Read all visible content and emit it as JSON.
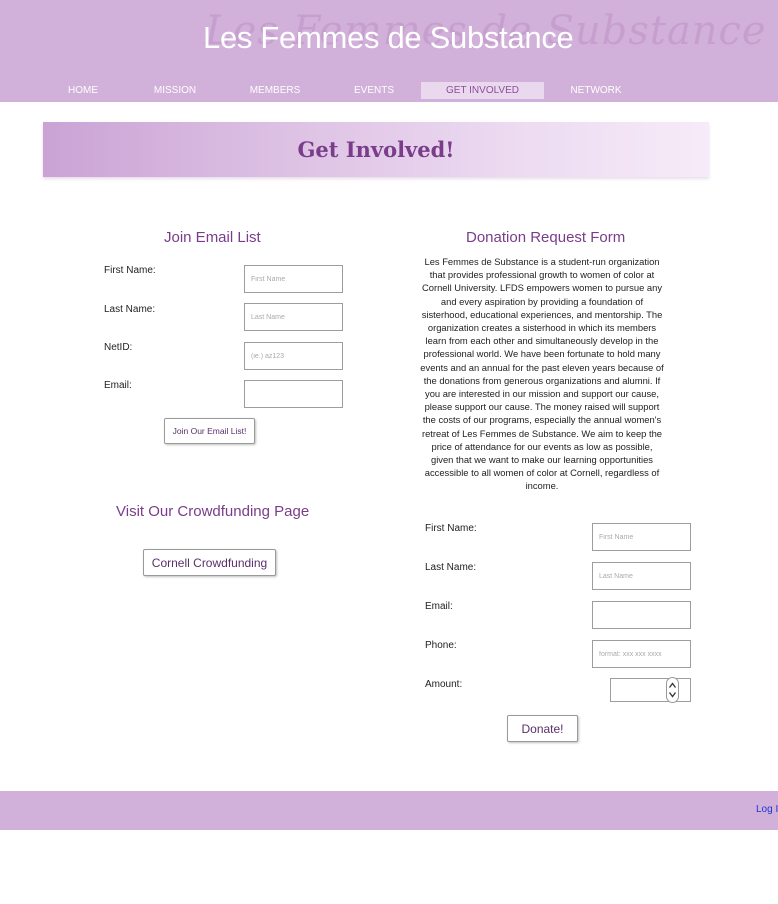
{
  "header": {
    "site_title": "Les Femmes de Substance",
    "nav": [
      {
        "label": "HOME"
      },
      {
        "label": "MISSION"
      },
      {
        "label": "MEMBERS"
      },
      {
        "label": "EVENTS"
      },
      {
        "label": "GET INVOLVED"
      },
      {
        "label": "NETWORK"
      }
    ]
  },
  "banner": {
    "title": "Get Involved!"
  },
  "email_list": {
    "heading": "Join Email List",
    "fields": [
      {
        "label": "First Name:",
        "placeholder": "First Name",
        "value": ""
      },
      {
        "label": "Last Name:",
        "placeholder": "Last Name",
        "value": ""
      },
      {
        "label": "NetID:",
        "placeholder": "(ie.) az123",
        "value": ""
      },
      {
        "label": "Email:",
        "placeholder": "",
        "value": ""
      }
    ],
    "submit_label": "Join Our Email List!"
  },
  "crowdfunding": {
    "heading": "Visit Our Crowdfunding Page",
    "button_label": "Cornell Crowdfunding"
  },
  "donation": {
    "heading": "Donation Request Form",
    "description": "Les Femmes de Substance is a student-run organization that provides professional growth to women of color at Cornell University. LFDS empowers women to pursue any and every aspiration by providing a foundation of sisterhood, educational experiences, and mentorship. The organization creates a sisterhood in which its members learn from each other and simultaneously develop in the professional world. We have been fortunate to hold many events and an annual for the past eleven years because of the donations from generous organizations and alumni. If you are interested in our mission and support our cause, please support our cause. The money raised will support the costs of our programs, especially the annual women's retreat of Les Femmes de Substance. We aim to keep the price of attendance for our events as low as possible, given that we want to make our learning opportunities accessible to all women of color at Cornell, regardless of income.",
    "fields": [
      {
        "label": "First Name:",
        "placeholder": "First Name",
        "value": ""
      },
      {
        "label": "Last Name:",
        "placeholder": "Last Name",
        "value": ""
      },
      {
        "label": "Email:",
        "placeholder": "",
        "value": ""
      },
      {
        "label": "Phone:",
        "placeholder": "format: xxx xxx xxxx",
        "value": ""
      }
    ],
    "amount_label": "Amount:",
    "amount_value": "",
    "submit_label": "Donate!"
  },
  "footer": {
    "login_label": "Log In"
  }
}
